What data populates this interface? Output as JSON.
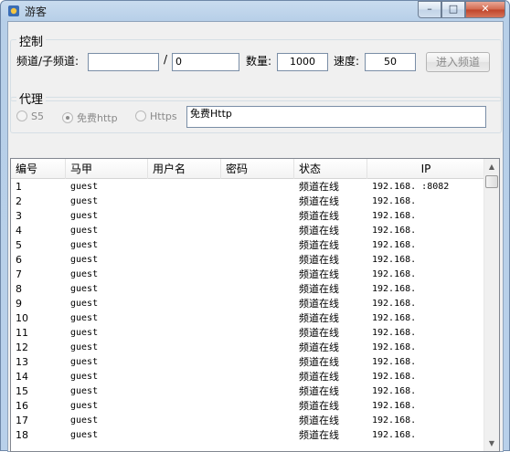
{
  "window": {
    "title": "游客",
    "minimize_glyph": "–",
    "maximize_glyph": "□",
    "close_glyph": "✕"
  },
  "control": {
    "group_label": "控制",
    "channel_label": "频道/子频道:",
    "channel_value": "",
    "separator": "/",
    "subchannel_value": "0",
    "quantity_label": "数量:",
    "quantity_value": "1000",
    "speed_label": "速度:",
    "speed_value": "50",
    "enter_button": "进入频道"
  },
  "proxy": {
    "group_label": "代理",
    "options": [
      {
        "label": "S5",
        "selected": false
      },
      {
        "label": "免费http",
        "selected": true
      },
      {
        "label": "Https",
        "selected": false
      }
    ],
    "text_value": "免费Http"
  },
  "table": {
    "columns": [
      "编号",
      "马甲",
      "用户名",
      "密码",
      "状态",
      "IP"
    ],
    "rows": [
      [
        "1",
        "guest",
        "",
        "",
        "频道在线",
        "192.168.      :8082"
      ],
      [
        "2",
        "guest",
        "",
        "",
        "频道在线",
        "192.168."
      ],
      [
        "3",
        "guest",
        "",
        "",
        "频道在线",
        "192.168."
      ],
      [
        "4",
        "guest",
        "",
        "",
        "频道在线",
        "192.168."
      ],
      [
        "5",
        "guest",
        "",
        "",
        "频道在线",
        "192.168."
      ],
      [
        "6",
        "guest",
        "",
        "",
        "频道在线",
        "192.168."
      ],
      [
        "7",
        "guest",
        "",
        "",
        "频道在线",
        "192.168."
      ],
      [
        "8",
        "guest",
        "",
        "",
        "频道在线",
        "192.168."
      ],
      [
        "9",
        "guest",
        "",
        "",
        "频道在线",
        "192.168."
      ],
      [
        "10",
        "guest",
        "",
        "",
        "频道在线",
        "192.168."
      ],
      [
        "11",
        "guest",
        "",
        "",
        "频道在线",
        "192.168."
      ],
      [
        "12",
        "guest",
        "",
        "",
        "频道在线",
        "192.168."
      ],
      [
        "13",
        "guest",
        "",
        "",
        "频道在线",
        "192.168."
      ],
      [
        "14",
        "guest",
        "",
        "",
        "频道在线",
        "192.168."
      ],
      [
        "15",
        "guest",
        "",
        "",
        "频道在线",
        "192.168."
      ],
      [
        "16",
        "guest",
        "",
        "",
        "频道在线",
        "192.168."
      ],
      [
        "17",
        "guest",
        "",
        "",
        "频道在线",
        "192.168."
      ],
      [
        "18",
        "guest",
        "",
        "",
        "频道在线",
        "192.168."
      ]
    ]
  },
  "scrollbar": {
    "up_glyph": "▲",
    "down_glyph": "▼"
  }
}
